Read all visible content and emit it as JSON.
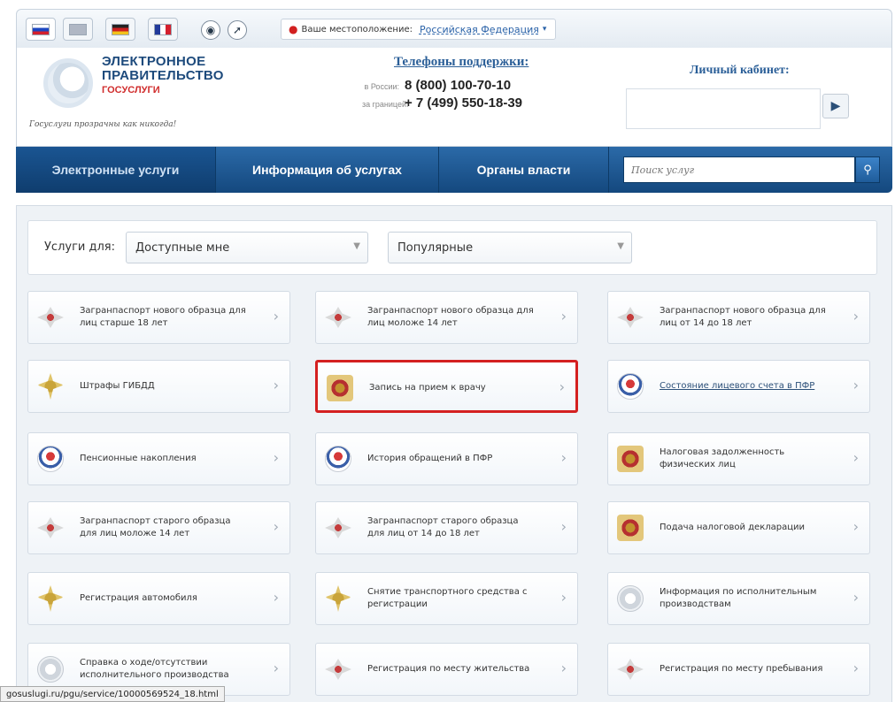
{
  "location": {
    "label": "Ваше местоположение:",
    "value": "Российская Федерация"
  },
  "logo": {
    "line1": "ЭЛЕКТРОННОЕ",
    "line2": "ПРАВИТЕЛЬСТВО",
    "subtitle": "ГОСУСЛУГИ",
    "slogan": "Госуслуги прозрачны как никогда!"
  },
  "support": {
    "title": "Телефоны поддержки:",
    "russia_note": "в России:",
    "russia_phone": "8 (800) 100-70-10",
    "abroad_note": "за границей:",
    "abroad_phone": "+ 7 (499) 550-18-39"
  },
  "cabinet": {
    "title": "Личный кабинет:"
  },
  "nav": {
    "tabs": [
      "Электронные услуги",
      "Информация об услугах",
      "Органы власти"
    ],
    "search_placeholder": "Поиск услуг"
  },
  "filter": {
    "label": "Услуги для:",
    "audience": "Доступные мне",
    "sort": "Популярные"
  },
  "services": [
    {
      "title": "Загранпаспорт нового образца для лиц старше 18 лет",
      "icon": "passport-icon"
    },
    {
      "title": "Загранпаспорт нового образца для лиц моложе 14 лет",
      "icon": "passport-icon"
    },
    {
      "title": "Загранпаспорт нового образца для лиц от 14 до 18 лет",
      "icon": "passport-icon"
    },
    {
      "title": "Штрафы ГИБДД",
      "icon": "police-eagle-icon"
    },
    {
      "title": "Запись на прием к врачу",
      "icon": "coat-of-arms-icon",
      "highlighted": true
    },
    {
      "title": "Состояние лицевого счета в ПФР",
      "icon": "pfr-icon",
      "link": true
    },
    {
      "title": "Пенсионные накопления",
      "icon": "pfr-icon"
    },
    {
      "title": "История обращений в ПФР",
      "icon": "pfr-icon"
    },
    {
      "title": "Налоговая задолженность физических лиц",
      "icon": "tax-icon"
    },
    {
      "title": "Загранпаспорт старого образца для лиц моложе 14 лет",
      "icon": "passport-icon"
    },
    {
      "title": "Загранпаспорт старого образца для лиц от 14 до 18 лет",
      "icon": "passport-icon"
    },
    {
      "title": "Подача налоговой декларации",
      "icon": "tax-icon"
    },
    {
      "title": "Регистрация автомобиля",
      "icon": "police-eagle-icon"
    },
    {
      "title": "Снятие транспортного средства с регистрации",
      "icon": "police-eagle-icon"
    },
    {
      "title": "Информация по исполнительным производствам",
      "icon": "bailiff-icon"
    },
    {
      "title": "Справка о ходе/отсутствии исполнительного производства",
      "icon": "bailiff-icon"
    },
    {
      "title": "Регистрация по месту жительства",
      "icon": "passport-icon"
    },
    {
      "title": "Регистрация по месту пребывания",
      "icon": "passport-icon"
    }
  ],
  "status_url": "gosuslugi.ru/pgu/service/10000569524_18.html"
}
